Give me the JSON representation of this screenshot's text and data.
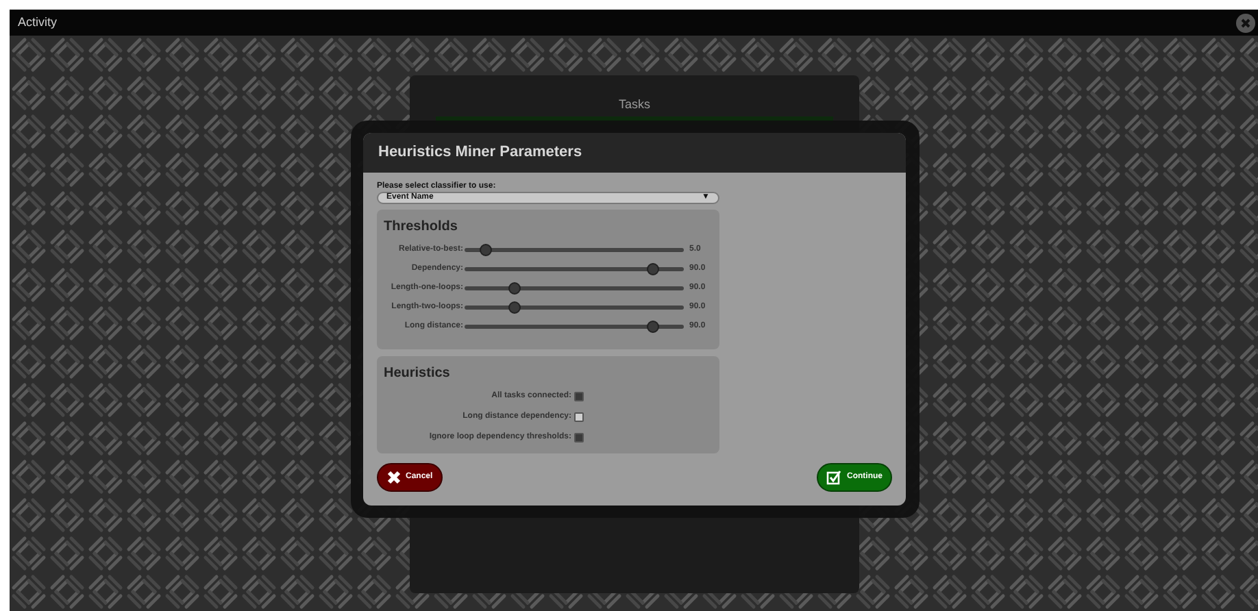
{
  "window": {
    "title": "Activity"
  },
  "background_panel": {
    "title": "Tasks"
  },
  "dialog": {
    "title": "Heuristics Miner Parameters",
    "classifier": {
      "label": "Please select classifier to use:",
      "value": "Event Name",
      "caret": "▼"
    },
    "thresholds": {
      "title": "Thresholds",
      "sliders": [
        {
          "label": "Relative-to-best:",
          "level": 0.07,
          "reading": "5.0"
        },
        {
          "label": "Dependency:",
          "level": 0.88,
          "reading": "90.0"
        },
        {
          "label": "Length-one-loops:",
          "level": 0.21,
          "reading": "90.0"
        },
        {
          "label": "Length-two-loops:",
          "level": 0.21,
          "reading": "90.0"
        },
        {
          "label": "Long distance:",
          "level": 0.88,
          "reading": "90.0"
        }
      ]
    },
    "heuristics": {
      "title": "Heuristics",
      "options": [
        {
          "label": "All tasks connected:",
          "checked": true
        },
        {
          "label": "Long distance dependency:",
          "checked": false
        },
        {
          "label": "Ignore loop dependency thresholds:",
          "checked": true
        }
      ]
    },
    "buttons": [
      {
        "kind": "cancel",
        "label": "Cancel"
      },
      {
        "kind": "continue",
        "label": "Continue"
      }
    ]
  }
}
